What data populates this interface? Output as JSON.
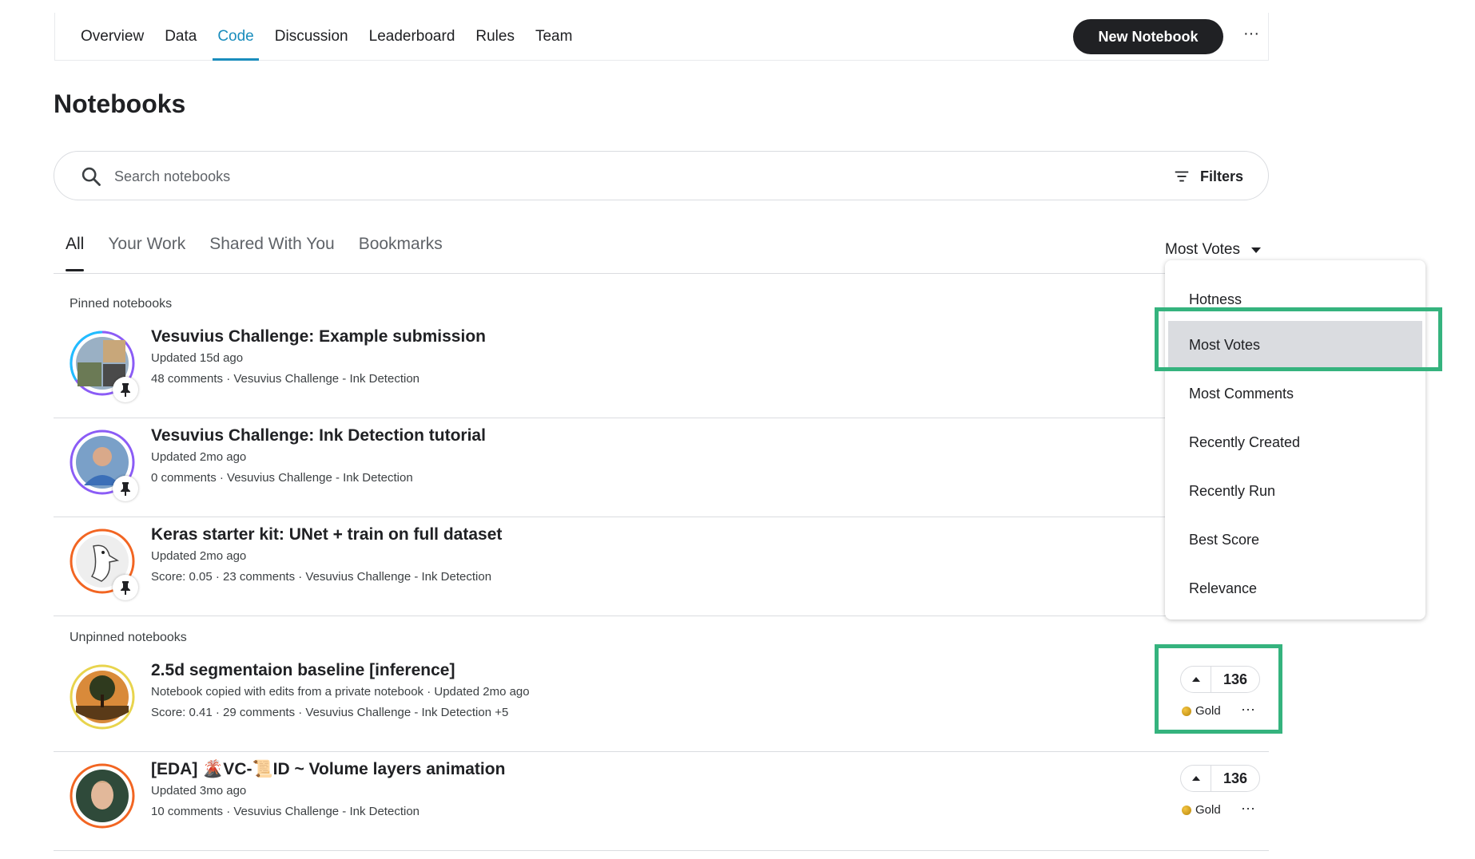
{
  "nav": {
    "tabs": [
      "Overview",
      "Data",
      "Code",
      "Discussion",
      "Leaderboard",
      "Rules",
      "Team"
    ],
    "active_tab": "Code",
    "new_notebook_label": "New Notebook",
    "more_label": "···"
  },
  "page_title": "Notebooks",
  "search": {
    "placeholder": "Search notebooks",
    "filters_label": "Filters"
  },
  "subtabs": {
    "items": [
      "All",
      "Your Work",
      "Shared With You",
      "Bookmarks"
    ],
    "active": "All"
  },
  "sort": {
    "current": "Most Votes",
    "options": [
      "Hotness",
      "Most Votes",
      "Most Comments",
      "Recently Created",
      "Recently Run",
      "Best Score",
      "Relevance"
    ]
  },
  "pinned_label": "Pinned notebooks",
  "unpinned_label": "Unpinned notebooks",
  "pinned": [
    {
      "title": "Vesuvius Challenge: Example submission",
      "updated": "Updated 15d ago",
      "meta": "48 comments · Vesuvius Challenge - Ink Detection"
    },
    {
      "title": "Vesuvius Challenge: Ink Detection tutorial",
      "updated": "Updated 2mo ago",
      "meta": "0 comments · Vesuvius Challenge - Ink Detection"
    },
    {
      "title": "Keras starter kit: UNet + train on full dataset",
      "updated": "Updated 2mo ago",
      "meta": "Score: 0.05 · 23 comments · Vesuvius Challenge - Ink Detection"
    }
  ],
  "unpinned": [
    {
      "title": "2.5d segmentaion baseline [inference]",
      "updated": "Notebook copied with edits from a private notebook · Updated 2mo ago",
      "meta": "Score: 0.41 · 29 comments · Vesuvius Challenge - Ink Detection +5",
      "votes": "136",
      "medal": "Gold"
    },
    {
      "title": "[EDA] 🌋VC-📜ID ~ Volume layers animation",
      "updated": "Updated 3mo ago",
      "meta": "10 comments · Vesuvius Challenge - Ink Detection",
      "votes": "136",
      "medal": "Gold"
    }
  ],
  "colors": {
    "accent": "#1a8dbd",
    "highlight": "#35b37e",
    "dark": "#202124"
  }
}
